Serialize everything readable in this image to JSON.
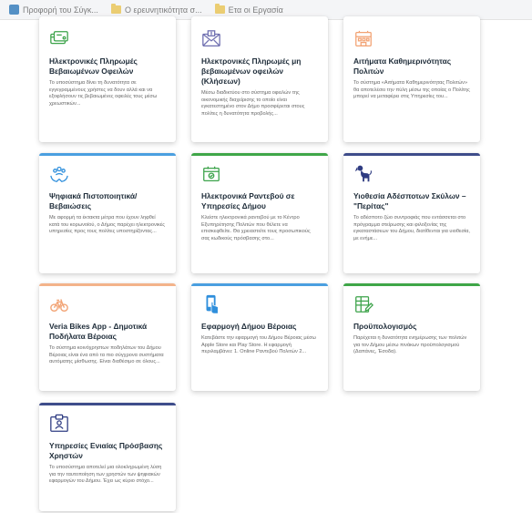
{
  "bookmarks": [
    {
      "label": "Προφορή του Σύγκ...",
      "type": "site"
    },
    {
      "label": "Ο ερευνητικότητα σ...",
      "type": "folder"
    },
    {
      "label": "Ετα οι Εργασία",
      "type": "folder"
    }
  ],
  "colors": {
    "orange_bar": "#f3b38a",
    "blue_bar": "#4a9fe0",
    "green_bar": "#3fa648",
    "navy_bar": "#3e4c8a",
    "icon_green": "#3ca34a",
    "icon_purple": "#6f6fb0",
    "icon_orange": "#f2a374",
    "icon_blue": "#2f8fdc",
    "icon_navy": "#2f3c82"
  },
  "cards": [
    {
      "title": "Ηλεκτρονικές Πληρωμές Βεβαιωμένων Οφειλών",
      "description": "Το υποσύστημα δίνει τη δυνατότητα σε εγγεγραμμένους χρήστες να δουν αλλά και να εξοφλήσουν τις βεβαιωμένες οφειλές τους μέσω χρεωστικών...",
      "icon": "credit-card-icon"
    },
    {
      "title": "Ηλεκτρονικές Πληρωμές μη βεβαιωμένων οφειλών (Κλήσεων)",
      "description": "Μέσω διαδικτύου στο σύστημα οφειλών της οικονομικής διαχείρισης το οποίο είναι εγκατεστημένο στον Δήμο προσφέρεται στους πολίτες η δυνατότητα προβολής...",
      "icon": "envelope-icon"
    },
    {
      "title": "Αιτήματα Καθημερινότητας Πολιτών",
      "description": "Το σύστημα «Αιτήματα Καθημερινότητας Πολιτών» θα αποτελέσει την πύλη μέσω της οποίας ο Πολίτης μπορεί να μεταφέρει στις Υπηρεσίες του...",
      "icon": "city-icon"
    },
    {
      "title": "Ψηφιακά Πιστοποιητικά/ Βεβαιώσεις",
      "description": "Με αφορμή τα έκτακτα μέτρα που έχουν ληφθεί κατά του κορωνοϊού, ο Δήμος παρέχει ηλεκτρονικές υπηρεσίες προς τους πολίτες υποστηρίζοντας...",
      "icon": "hands-people-icon"
    },
    {
      "title": "Ηλεκτρονικά Ραντεβού σε Υπηρεσίες Δήμου",
      "description": "Κλείστε ηλεκτρονικά ραντεβού με το Κέντρο Εξυπηρέτησης Πολιτών που θέλετε να επισκεφθείτε. Θα χρειαστείτε τους προσωπικούς σας κωδικούς πρόσβασης στο...",
      "icon": "calendar-check-icon"
    },
    {
      "title": "Υιοθεσία Αδέσποτων Σκύλων – \"Περίτας\"",
      "description": "Το αδέσποτο ζώο συντροφιάς που εντάσσεται στο πρόγραμμα στείρωσης και φιλοξενίας της εγκαταστάσεων του Δήμου, διατίθενται για υιοθεσία, με ενήμε...",
      "icon": "dog-icon"
    },
    {
      "title": "Veria Bikes App - Δημοτικά Ποδήλατα Βέροιας",
      "description": "Το σύστημα κοινόχρηστων ποδηλάτων του Δήμου Βέροιας είναι ένα από τα πιο σύγχρονα συστήματα αυτόματης μίσθωσης. Είναι διαθέσιμο σε όλους...",
      "icon": "bicycle-icon"
    },
    {
      "title": "Εφαρμογή Δήμου Βέροιας",
      "description": "Κατεβάστε την εφαρμογή του Δήμου Βέροιας μέσω Apple Store και Play Store. Η εφαρμογή περιλαμβάνει: 1. Online Ραντεβού Πολιτών 2...",
      "icon": "mobile-touch-icon"
    },
    {
      "title": "Προϋπολογισμός",
      "description": "Παρέχεται η δυνατότητα ενημέρωσης των πολιτών για τον Δήμου μέσω πινάκων προϋπολογισμού (Δαπάνες, Έσοδα).",
      "icon": "spreadsheet-icon"
    },
    {
      "title": "Υπηρεσίες Ενιαίας Πρόσβασης Χρηστών",
      "description": "Το υποσύστημα αποτελεί μια ολοκληρωμένη λύση για την ταυτοποίηση των χρηστών των ψηφιακών εφαρμογών του Δήμου. Έχει ως κύριο στόχο...",
      "icon": "id-access-icon"
    }
  ]
}
